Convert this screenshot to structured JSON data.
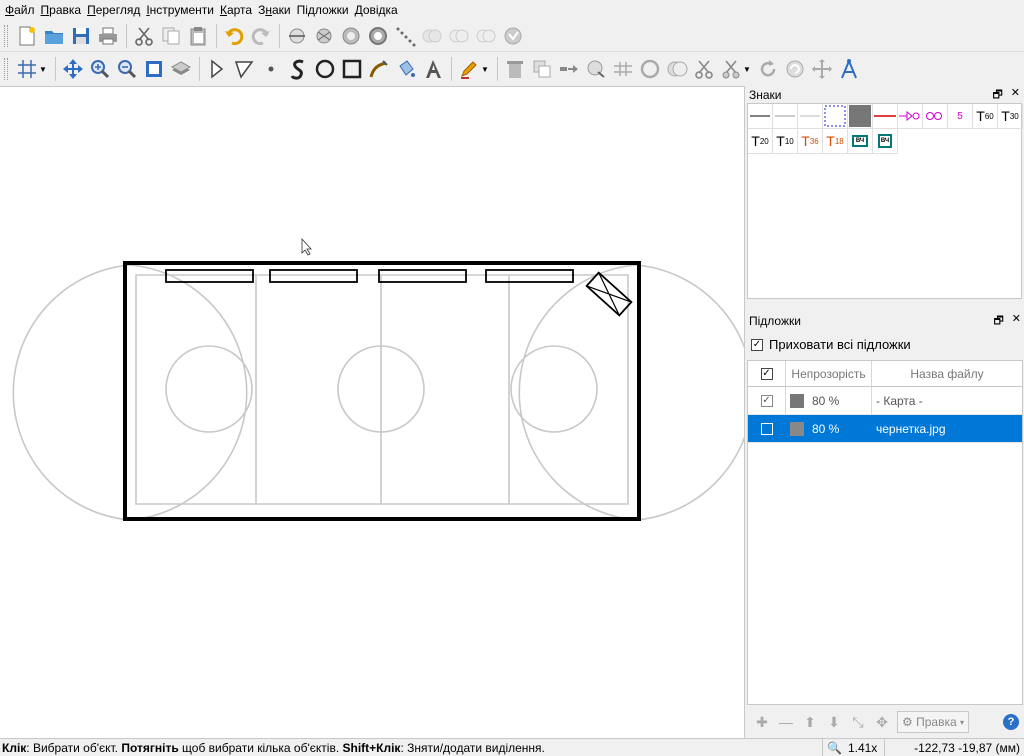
{
  "menu": [
    {
      "pre": "",
      "ul": "Ф",
      "post": "айл"
    },
    {
      "pre": "",
      "ul": "П",
      "post": "равка"
    },
    {
      "pre": "",
      "ul": "П",
      "post": "ерегляд"
    },
    {
      "pre": "",
      "ul": "І",
      "post": "нструменти"
    },
    {
      "pre": "",
      "ul": "К",
      "post": "арта"
    },
    {
      "pre": "З",
      "ul": "н",
      "post": "аки"
    },
    {
      "pre": "Підложки",
      "ul": "",
      "post": ""
    },
    {
      "pre": "",
      "ul": "Д",
      "post": "овідка"
    }
  ],
  "symbols_panel": {
    "title": "Знаки",
    "row1": [
      "",
      "",
      "",
      "",
      "",
      "",
      "",
      "",
      "5",
      "T60",
      "T30",
      "T20"
    ],
    "text_syms": {
      "s5": "5",
      "t60": "T",
      "t60s": "60",
      "t30": "T",
      "t30s": "30",
      "t20": "T",
      "t20s": "20",
      "t10": "T",
      "t10s": "10",
      "t36": "T",
      "t36s": "36",
      "t18": "T",
      "t18s": "18",
      "box1": "ВЧ",
      "box2": "ВЧ"
    }
  },
  "templates_panel": {
    "title": "Підложки",
    "hide_all_label": "Приховати всі підложки",
    "hide_all_checked": true,
    "columns": {
      "opacity": "Непрозорість",
      "filename": "Назва файлу"
    },
    "rows": [
      {
        "checked": true,
        "opacity": "80 %",
        "filename": "- Карта -",
        "selected": false
      },
      {
        "checked": false,
        "opacity": "80 %",
        "filename": "чернетка.jpg",
        "selected": true
      }
    ],
    "edit_button": "Правка"
  },
  "status": {
    "click_b": "Клік",
    "click_t": ": Вибрати об'єкт. ",
    "drag_b": "Потягніть",
    "drag_t": " щоб вибрати кілька об'єктів. ",
    "shift_b": "Shift+Клік",
    "shift_t": ": Зняти/додати виділення.",
    "zoom": "1.41x",
    "coords": "-122,73 -19,87 (мм)"
  }
}
